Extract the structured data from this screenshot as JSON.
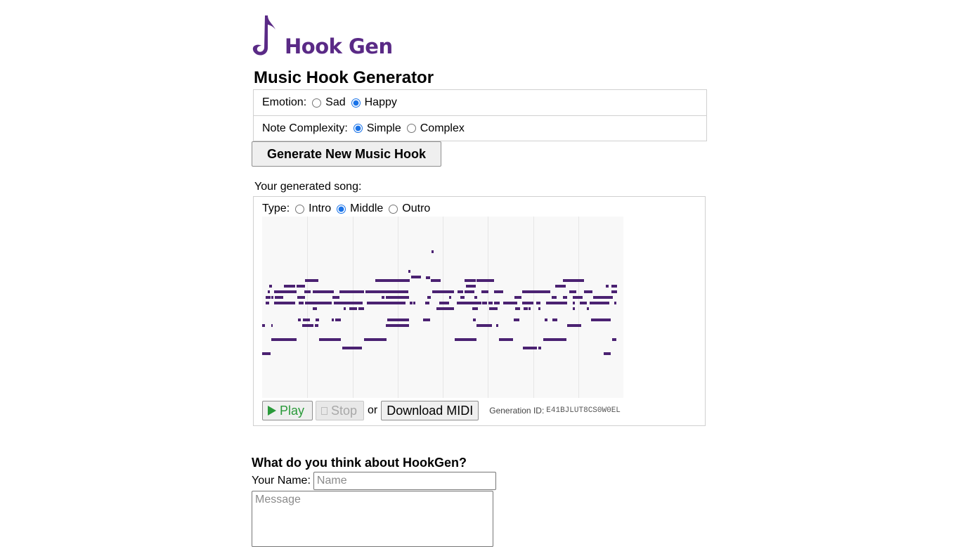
{
  "brand": {
    "name": "Hook Gen",
    "color": "#5a2a86",
    "logo_icon": "music-note-icon"
  },
  "page_title": "Music Hook Generator",
  "options": {
    "emotion": {
      "label": "Emotion:",
      "choices": [
        "Sad",
        "Happy"
      ],
      "selected": "Happy"
    },
    "complexity": {
      "label": "Note Complexity:",
      "choices": [
        "Simple",
        "Complex"
      ],
      "selected": "Simple"
    }
  },
  "generate_button": "Generate New Music Hook",
  "song": {
    "label": "Your generated song:",
    "type": {
      "label": "Type:",
      "choices": [
        "Intro",
        "Middle",
        "Outro"
      ],
      "selected": "Middle"
    },
    "note_color": "#4b2272",
    "piano_roll_bars": 8
  },
  "controls": {
    "play": "Play",
    "stop": "Stop",
    "or": "or",
    "download": "Download MIDI",
    "generation_id_label": "Generation ID:",
    "generation_id": "E41BJLUT8CS0W0EL"
  },
  "feedback": {
    "title": "What do you think about HookGen?",
    "name_label": "Your Name:",
    "name_placeholder": "Name",
    "message_placeholder": "Message"
  }
}
